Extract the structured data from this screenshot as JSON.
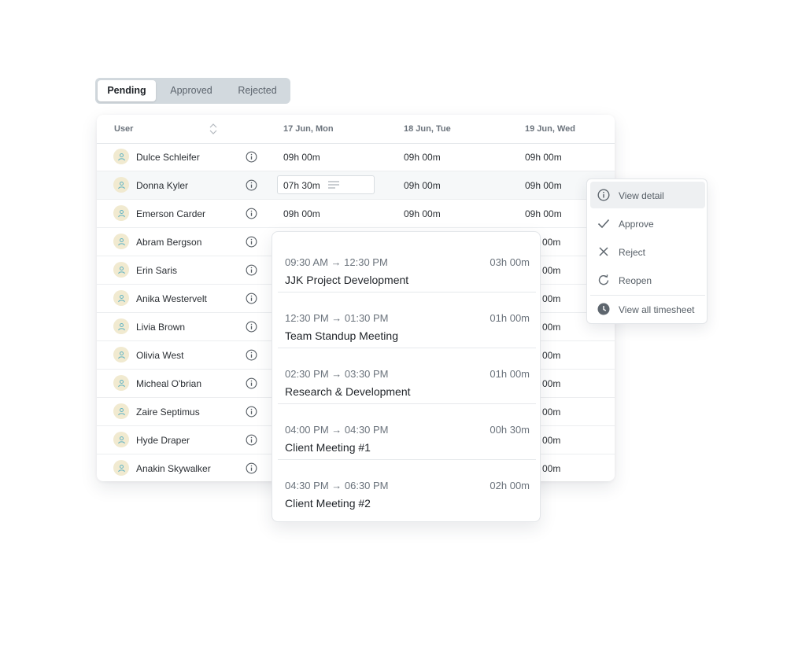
{
  "tabs": [
    {
      "label": "Pending",
      "active": true
    },
    {
      "label": "Approved",
      "active": false
    },
    {
      "label": "Rejected",
      "active": false
    }
  ],
  "table": {
    "columns": {
      "user": "User",
      "d1": "17 Jun, Mon",
      "d2": "18 Jun, Tue",
      "d3": "19 Jun, Wed"
    },
    "rows": [
      {
        "name": "Dulce Schleifer",
        "d1": "09h 00m",
        "d2": "09h 00m",
        "d3": "09h 00m"
      },
      {
        "name": "Donna Kyler",
        "d1": "07h 30m",
        "d2": "09h 00m",
        "d3": "09h 00m"
      },
      {
        "name": "Emerson Carder",
        "d1": "09h 00m",
        "d2": "09h 00m",
        "d3": "09h 00m"
      },
      {
        "name": "Abram Bergson",
        "d3": "00m"
      },
      {
        "name": "Erin Saris",
        "d3": "00m"
      },
      {
        "name": "Anika Westervelt",
        "d3": "00m"
      },
      {
        "name": "Livia Brown",
        "d3": "00m"
      },
      {
        "name": "Olivia West",
        "d3": "00m"
      },
      {
        "name": "Micheal O'brian",
        "d3": "00m"
      },
      {
        "name": "Zaire Septimus",
        "d3": "00m"
      },
      {
        "name": "Hyde Draper",
        "d3": "00m"
      },
      {
        "name": "Anakin Skywalker",
        "d3": "00m"
      }
    ]
  },
  "popup": {
    "entries": [
      {
        "time": "09:30 AM → 12:30 PM",
        "duration": "03h 00m",
        "title": "JJK Project Development"
      },
      {
        "time": "12:30 PM → 01:30 PM",
        "duration": "01h 00m",
        "title": "Team Standup Meeting"
      },
      {
        "time": "02:30 PM → 03:30 PM",
        "duration": "01h 00m",
        "title": "Research & Development"
      },
      {
        "time": "04:00 PM → 04:30 PM",
        "duration": "00h 30m",
        "title": "Client Meeting #1"
      },
      {
        "time": "04:30 PM → 06:30 PM",
        "duration": "02h 00m",
        "title": "Client Meeting #2"
      }
    ]
  },
  "menu": {
    "items": [
      {
        "label": "View detail",
        "icon": "info-icon",
        "active": true
      },
      {
        "label": "Approve",
        "icon": "check-icon",
        "active": false
      },
      {
        "label": "Reject",
        "icon": "close-icon",
        "active": false
      },
      {
        "label": "Reopen",
        "icon": "refresh-icon",
        "active": false
      },
      {
        "label": "View all timesheet",
        "icon": "clock-icon",
        "active": false
      }
    ]
  },
  "colors": {
    "accent_avatar_bg": "#f1ead0",
    "avatar_icon": "#5fb3c4",
    "tab_bg": "#d2d9de"
  }
}
